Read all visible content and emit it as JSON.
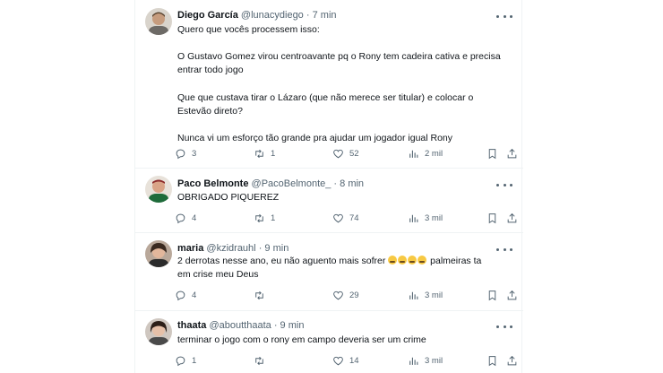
{
  "tweets": [
    {
      "name": "Diego García",
      "handle": "@lunacydiego",
      "sep": "·",
      "time": "7 min",
      "lines": [
        "Quero que vocês processem isso:",
        "O Gustavo Gomez virou centroavante pq o Rony tem cadeira cativa e precisa",
        "entrar todo jogo",
        "Que que custava tirar o Lázaro (que não merece ser titular) e colocar o",
        "Estevão direto?",
        "Nunca vi um esforço tão grande pra ajudar um jogador igual Rony"
      ],
      "replies": "3",
      "retweets": "1",
      "likes": "52",
      "views": "2 mil"
    },
    {
      "name": "Paco Belmonte",
      "handle": "@PacoBelmonte_",
      "sep": "·",
      "time": "8 min",
      "text": "OBRIGADO PIQUEREZ",
      "replies": "4",
      "retweets": "1",
      "likes": "74",
      "views": "3 mil"
    },
    {
      "name": "maria",
      "handle": "@kzidrauhl",
      "sep": "·",
      "time": "9 min",
      "line1": "2 derrotas nesse ano, eu não aguento mais sofrer",
      "line1_after": "palmeiras ta",
      "line2": "em crise meu Deus",
      "replies": "4",
      "retweets": "",
      "likes": "29",
      "views": "3 mil"
    },
    {
      "name": "thaata",
      "handle": "@aboutthaata",
      "sep": "·",
      "time": "9 min",
      "text": "terminar o jogo com o rony em campo deveria ser um crime",
      "replies": "1",
      "retweets": "",
      "likes": "14",
      "views": "3 mil"
    }
  ],
  "icons": {
    "reply": "reply-icon",
    "retweet": "retweet-icon",
    "like": "heart-icon",
    "views": "views-chart-icon",
    "bookmark": "bookmark-icon",
    "share": "share-icon",
    "more": "more-icon",
    "emoji": "crying-face-emoji"
  }
}
